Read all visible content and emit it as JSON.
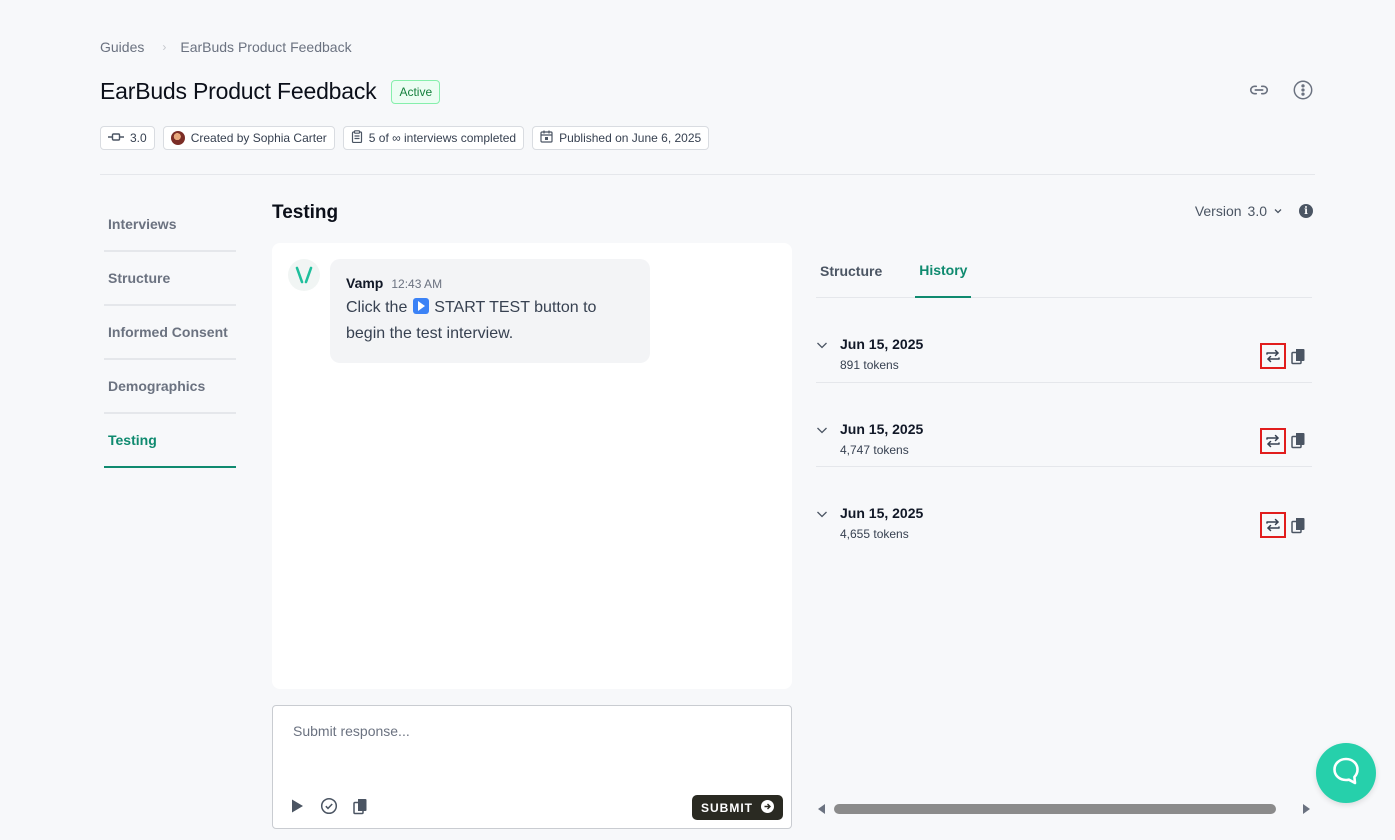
{
  "breadcrumb": {
    "root": "Guides",
    "separator": "›",
    "current": "EarBuds Product Feedback"
  },
  "header": {
    "title": "EarBuds Product Feedback",
    "status": "Active",
    "actions": [
      {
        "icon": "link-icon"
      },
      {
        "icon": "more-vertical-icon"
      }
    ]
  },
  "meta": {
    "version": "3.0",
    "creator": "Created by Sophia Carter",
    "interviews": "5 of ∞ interviews completed",
    "published": "Published on June 6, 2025"
  },
  "sidebar": {
    "items": [
      {
        "label": "Interviews",
        "active": false
      },
      {
        "label": "Structure",
        "active": false
      },
      {
        "label": "Informed Consent",
        "active": false
      },
      {
        "label": "Demographics",
        "active": false
      },
      {
        "label": "Testing",
        "active": true
      }
    ]
  },
  "main": {
    "section_title": "Testing",
    "version_label": "Version",
    "version_value": "3.0"
  },
  "chat": {
    "messages": [
      {
        "sender": "Vamp",
        "time": "12:43 AM",
        "text_before": "Click the",
        "emoji": "play-button-emoji",
        "text_after": "START TEST button to begin the test interview."
      }
    ]
  },
  "composer": {
    "placeholder": "Submit response...",
    "value": "",
    "tools": [
      {
        "icon": "play-icon"
      },
      {
        "icon": "check-circle-icon"
      },
      {
        "icon": "copy-icon"
      }
    ],
    "submit_label": "SUBMIT"
  },
  "right_panel": {
    "tabs": [
      {
        "label": "Structure",
        "active": false
      },
      {
        "label": "History",
        "active": true
      }
    ],
    "history": [
      {
        "date": "Jun 15, 2025",
        "tokens": "891 tokens"
      },
      {
        "date": "Jun 15, 2025",
        "tokens": "4,747 tokens"
      },
      {
        "date": "Jun 15, 2025",
        "tokens": "4,655 tokens"
      }
    ],
    "scrollbar": {
      "position": 0,
      "visible_fraction": 0.96
    }
  },
  "colors": {
    "accent": "#0f8a6f",
    "fab": "#26d0ab",
    "highlight_outline": "#e11d1d",
    "submit_bg": "#2a2a22"
  },
  "help_widget": {
    "icon": "chat-bubble-icon"
  }
}
